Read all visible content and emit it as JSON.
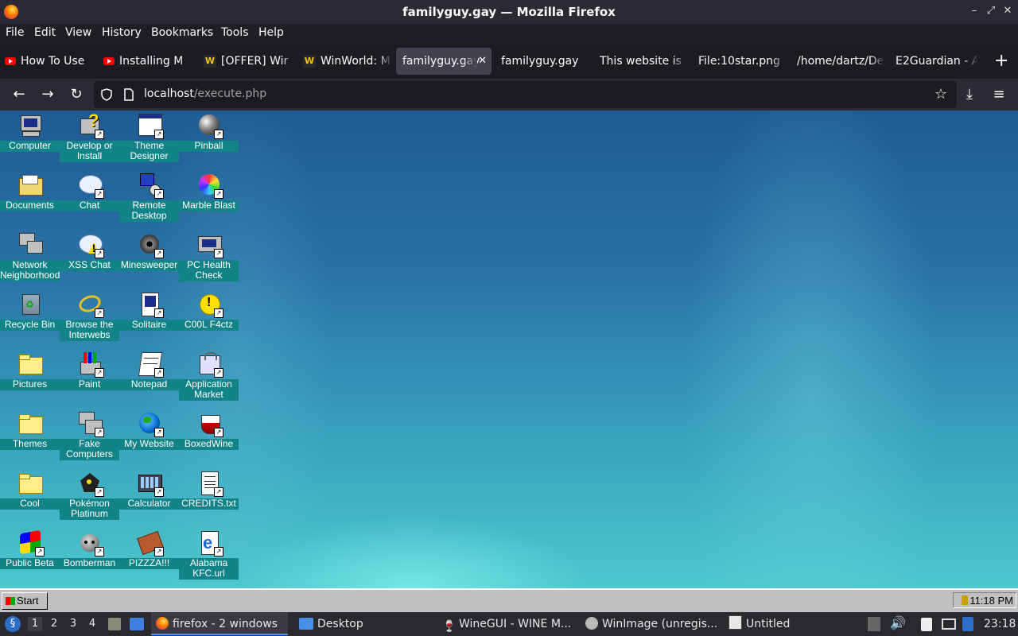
{
  "window": {
    "title": "familyguy.gay — Mozilla Firefox",
    "controls": [
      "minimize",
      "maximize",
      "close"
    ]
  },
  "menu": [
    "File",
    "Edit",
    "View",
    "History",
    "Bookmarks",
    "Tools",
    "Help"
  ],
  "tabs": [
    {
      "label": "How To Use",
      "icon": "youtube-icon"
    },
    {
      "label": "Installing M",
      "icon": "youtube-icon"
    },
    {
      "label": "[OFFER] Wir",
      "icon": "winworld-icon"
    },
    {
      "label": "WinWorld: M",
      "icon": "winworld-icon"
    },
    {
      "label": "familyguy.gay",
      "icon": "none",
      "active": true
    },
    {
      "label": "familyguy.gay",
      "icon": "none"
    },
    {
      "label": "This website is",
      "icon": "none"
    },
    {
      "label": "File:10star.png",
      "icon": "none"
    },
    {
      "label": "/home/dartz/De",
      "icon": "none"
    },
    {
      "label": "E2Guardian - A",
      "icon": "none"
    }
  ],
  "nav": {
    "url_host": "localhost",
    "url_path": "/execute.php"
  },
  "desktop_icons": [
    {
      "label": "Computer"
    },
    {
      "label": "Develop or Install"
    },
    {
      "label": "Theme Designer"
    },
    {
      "label": "Pinball"
    },
    {
      "label": "Documents"
    },
    {
      "label": "Chat"
    },
    {
      "label": "Remote Desktop"
    },
    {
      "label": "Marble Blast"
    },
    {
      "label": "Network Neighborhood"
    },
    {
      "label": "XSS Chat"
    },
    {
      "label": "Minesweeper"
    },
    {
      "label": "PC Health Check"
    },
    {
      "label": "Recycle Bin"
    },
    {
      "label": "Browse the Interwebs"
    },
    {
      "label": "Solitaire"
    },
    {
      "label": "C00L F4ctz"
    },
    {
      "label": "Pictures"
    },
    {
      "label": "Paint"
    },
    {
      "label": "Notepad"
    },
    {
      "label": "Application Market"
    },
    {
      "label": "Themes"
    },
    {
      "label": "Fake Computers"
    },
    {
      "label": "My Website"
    },
    {
      "label": "BoxedWine"
    },
    {
      "label": "Cool"
    },
    {
      "label": "Pokémon Platinum"
    },
    {
      "label": "Calculator"
    },
    {
      "label": "CREDITS.txt"
    },
    {
      "label": "Public Beta"
    },
    {
      "label": "Bomberman"
    },
    {
      "label": "PIZZZA!!!"
    },
    {
      "label": "Alabama KFC.url"
    }
  ],
  "win98_taskbar": {
    "start_label": "Start",
    "clock": "11:18 PM"
  },
  "system_taskbar": {
    "workspaces": [
      "1",
      "2",
      "3",
      "4"
    ],
    "tasks": [
      {
        "label": "firefox - 2 windows",
        "icon": "firefox-icon",
        "active": true
      },
      {
        "label": "Desktop",
        "icon": "folder-icon"
      },
      {
        "label": "WineGUI - WINE M...",
        "icon": "wine-icon"
      },
      {
        "label": "WinImage (unregis...",
        "icon": "winimage-icon"
      },
      {
        "label": "Untitled",
        "icon": "text-editor-icon"
      }
    ],
    "clock": "23:18"
  }
}
